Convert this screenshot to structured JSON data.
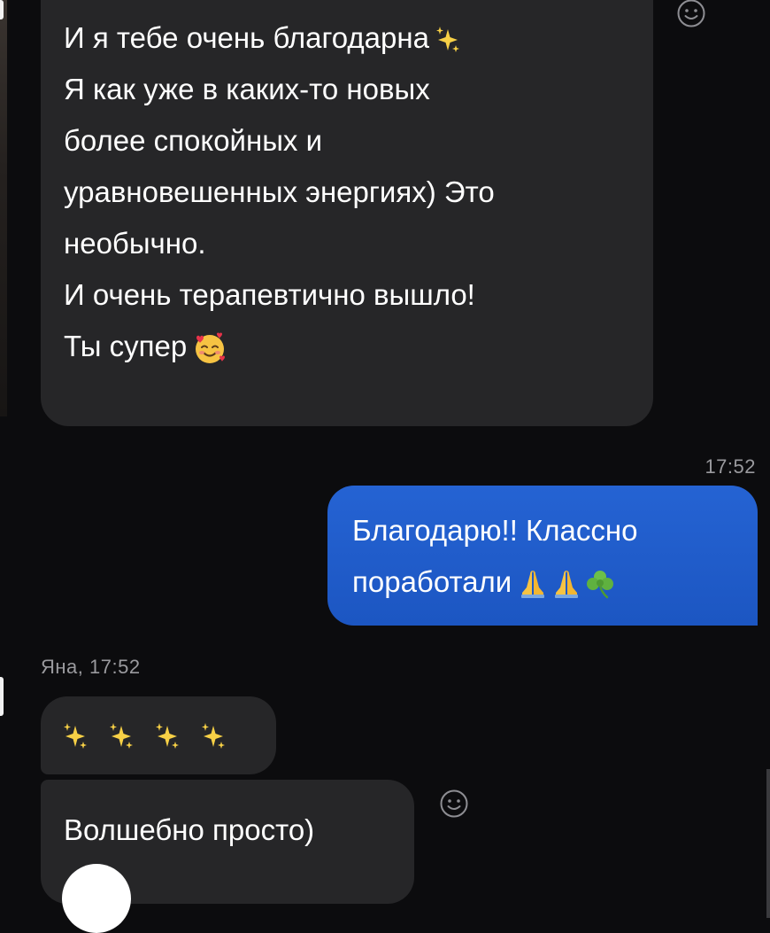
{
  "chat": {
    "messages": {
      "m1": {
        "direction": "incoming",
        "lines": [
          "И я тебе очень благодарна",
          "Я как уже в каких-то новых",
          "более спокойных и",
          "уравновешенных энергиях) Это",
          "необычно.",
          "И очень терапевтично вышло!",
          "Ты супер"
        ],
        "emoji": [
          "sparkles",
          "smiling-face-with-hearts"
        ]
      },
      "m2": {
        "direction": "outgoing",
        "time": "17:52",
        "lines": [
          "Благодарю!! Классно",
          "поработали"
        ],
        "emoji": [
          "folded-hands",
          "folded-hands",
          "shamrock"
        ]
      },
      "m3": {
        "direction": "incoming",
        "sender_meta": "Яна, 17:52",
        "emoji": [
          "sparkles",
          "sparkles",
          "sparkles",
          "sparkles"
        ]
      },
      "m4": {
        "direction": "incoming",
        "text": "Волшебно просто)"
      }
    }
  },
  "colors": {
    "background": "#0c0c0e",
    "incoming_bubble": "#262628",
    "outgoing_bubble": "#1e5ed4",
    "meta_text": "#9a9a9e",
    "sparkle": "#f7d046"
  }
}
